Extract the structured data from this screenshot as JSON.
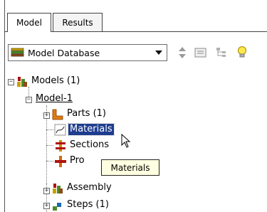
{
  "tabs": [
    {
      "label": "Model",
      "active": true
    },
    {
      "label": "Results",
      "active": false
    }
  ],
  "model_selector": {
    "value": "Model Database"
  },
  "toolbar_icons": [
    "up-down-arrows-icon",
    "filter-icon",
    "tree-icon",
    "lightbulb-icon"
  ],
  "tree": {
    "root_label": "Models (1)",
    "model_label": "Model-1",
    "parts_label": "Parts (1)",
    "materials_label": "Materials",
    "sections_label": "Sections",
    "profiles_label": "Pro",
    "assembly_label": "Assembly",
    "steps_label": "Steps (1)"
  },
  "tooltip": {
    "text": "Materials"
  },
  "colors": {
    "selection": "#1e3d8f",
    "tooltip_bg": "#ffffe1"
  }
}
